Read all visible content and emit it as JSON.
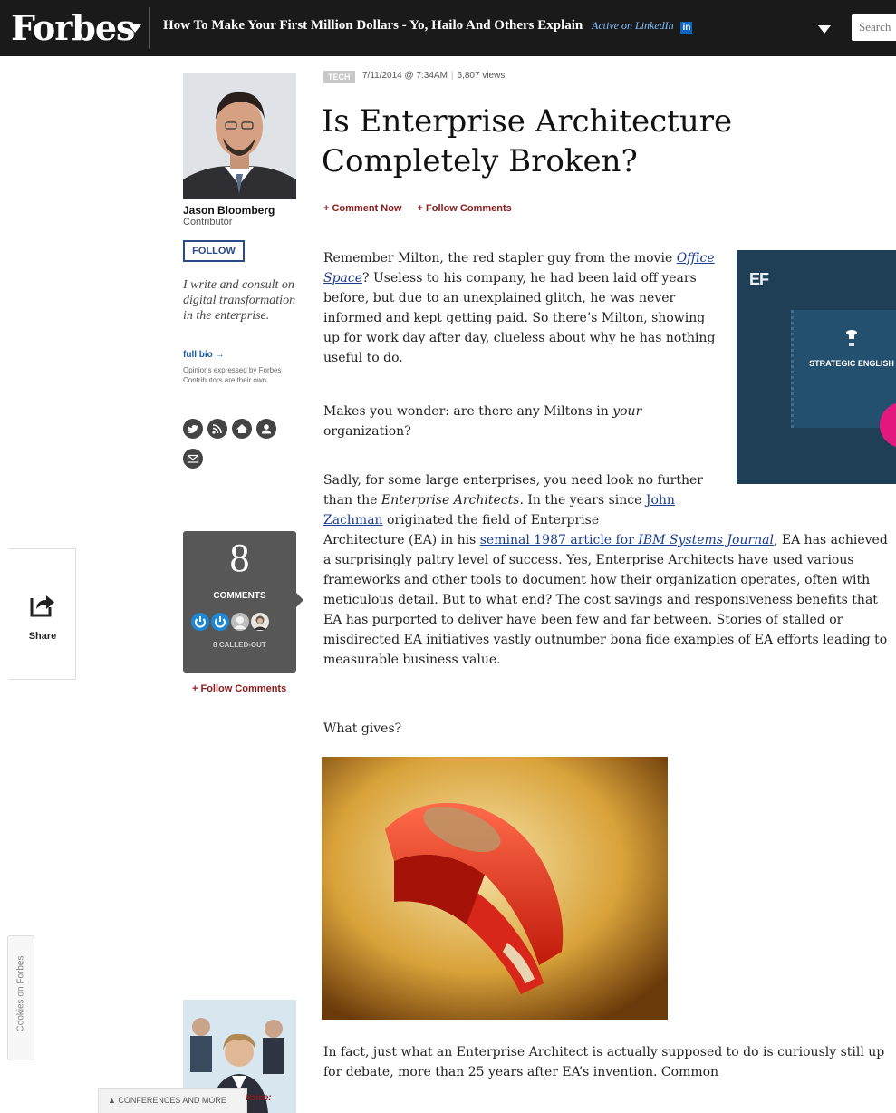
{
  "topbar": {
    "logo": "Forbes",
    "headline": "How To Make Your First Million Dollars - Yo, Hailo And Others Explain",
    "active_on": "Active on LinkedIn",
    "linkedin_icon": "in",
    "search_placeholder": "Search"
  },
  "author": {
    "name": "Jason Bloomberg",
    "role": "Contributor",
    "follow_label": "FOLLOW",
    "bio": "I write and consult on digital transformation in the enterprise.",
    "full_bio": "full bio →",
    "opinions": "Opinions expressed by Forbes Contributors are their own.",
    "social_icons": [
      "twitter-icon",
      "rss-icon",
      "home-icon",
      "profile-icon",
      "email-icon"
    ]
  },
  "comments": {
    "count": "8",
    "label": "COMMENTS",
    "called_out": "8 CALLED-OUT",
    "follow": "+ Follow Comments"
  },
  "share": {
    "label": "Share"
  },
  "cookies": {
    "label": "Cookies on Forbes"
  },
  "article": {
    "tag": "TECH",
    "date": "7/11/2014 @ 7:34AM",
    "views": "6,807 views",
    "title": "Is Enterprise Architecture Completely Broken?",
    "comment_now": "+ Comment Now",
    "follow_comments": "+ Follow Comments",
    "p1_a": "Remember Milton, the red stapler guy from the movie ",
    "p1_link": "Office Space",
    "p1_b": "? Useless to his company, he had been laid off years before, but due to an unexplained glitch, he was never informed and kept getting paid. So there’s Milton, showing up for work day after day, clueless about why he has nothing useful to do.",
    "p2_a": "Makes you wonder: are there any Miltons in ",
    "p2_em": "your",
    "p2_b": " organization?",
    "p3_a": "Sadly, for some large enterprises, you need look no further than the ",
    "p3_em": "Enterprise Architects",
    "p3_b": ". In the years since ",
    "p3_link1": "John Zachman",
    "p3_c": " originated the field of Enterprise",
    "p4_a": "Architecture (EA) in his ",
    "p4_link": "seminal 1987 article for ",
    "p4_link_em": "IBM Systems Journal",
    "p4_b": ", EA has achieved a surprisingly paltry level of success. Yes, Enterprise Architects have used various frameworks and other tools to document how their organization operates, often with meticulous detail. But to what end? The cost savings and responsiveness benefits that EA has purported to deliver have been few and far between. Stories of stalled or misdirected EA initiatives vastly outnumber bona fide examples of EA efforts leading to measurable business value.",
    "p5": "What gives?",
    "p6": "In fact, just what an Enterprise Architect is actually supposed to do is curiously still up for debate, more than 25 years after EA’s invention. Common"
  },
  "ad": {
    "logo": "EF",
    "title": "STRATEGIC ENGLISH"
  },
  "footer": {
    "conferences": "▲  CONFERENCES AND MORE",
    "voice": "Voice:"
  },
  "colors": {
    "topbar": "#1a1a1a",
    "accent_red": "#8b1a1a",
    "link_blue": "#1a3d8f",
    "follow_blue": "#2a4a8a"
  }
}
